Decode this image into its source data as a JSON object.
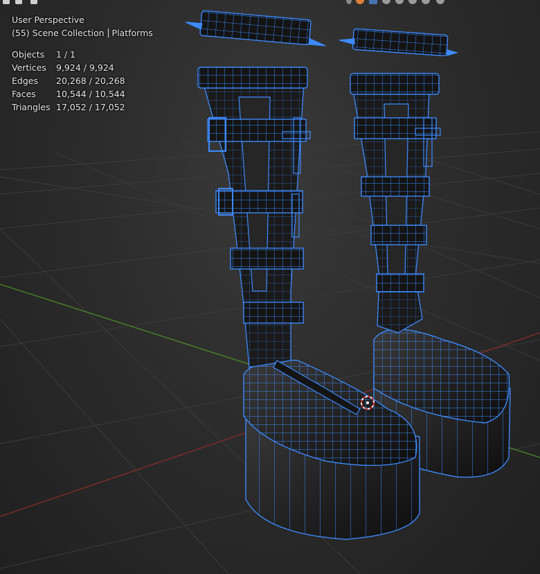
{
  "viewport": {
    "view_name": "User Perspective",
    "collection": "(55) Scene Collection",
    "object_name": "Platforms"
  },
  "stats": [
    {
      "label": "Objects",
      "value": "1 / 1"
    },
    {
      "label": "Vertices",
      "value": "9,924 / 9,924"
    },
    {
      "label": "Edges",
      "value": "20,268 / 20,268"
    },
    {
      "label": "Faces",
      "value": "10,544 / 10,544"
    },
    {
      "label": "Triangles",
      "value": "17,052 / 17,052"
    }
  ],
  "colors": {
    "wire": "#3d8bff",
    "wire_light": "#8fc4ff",
    "x_axis": "#8c2a2a",
    "y_axis": "#4d8a2a",
    "grid": "#3b3b3b"
  },
  "icons": [
    "select-box-icon",
    "select-lasso-icon",
    "render-engine-icon",
    "viewport-shading-icon",
    "overlay-icon",
    "search-icon",
    "3d-cursor-icon"
  ]
}
